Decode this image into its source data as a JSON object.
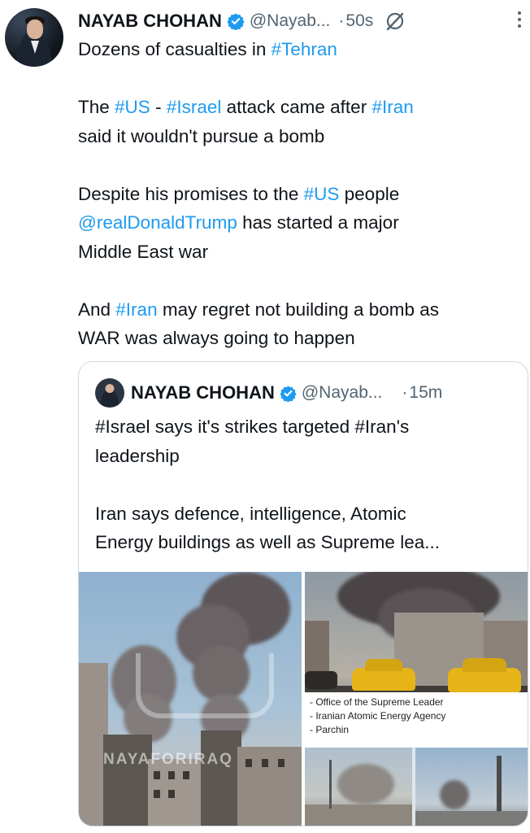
{
  "tweet": {
    "author_name": "NAYAB CHOHAN",
    "handle": "@Nayab...",
    "separator": "·",
    "time": "50s",
    "lines": {
      "l1a": "Dozens of casualties in ",
      "l1b": "#Tehran",
      "l2a": "The ",
      "l2b": "#US",
      "l2c": " - ",
      "l2d": "#Israel",
      "l2e": " attack came after ",
      "l2f": "#Iran",
      "l3": "said it wouldn't pursue a bomb",
      "l4a": "Despite his promises to the ",
      "l4b": "#US",
      "l4c": " people",
      "l5a": "@realDonaldTrump",
      "l5b": " has started a major",
      "l6": "Middle East war",
      "l7a": "And ",
      "l7b": "#Iran",
      "l7c": " may regret not building a bomb as",
      "l8": "WAR was always going to happen"
    }
  },
  "quote": {
    "author_name": "NAYAB CHOHAN",
    "handle": "@Nayab...",
    "separator": "·",
    "time": "15m",
    "line1": "#Israel says it's strikes targeted #Iran's",
    "line2": "leadership",
    "line3": "Iran says defence, intelligence, Atomic",
    "line4": "Energy buildings as well as Supreme lea...",
    "image_caption": [
      "- Office of the Supreme Leader",
      "- Iranian Atomic Energy Agency",
      "- Parchin"
    ],
    "watermark": "NAYAFORIRAQ"
  },
  "colors": {
    "link": "#1d9bf0",
    "muted": "#536471",
    "text": "#0f1419",
    "border": "#cfd9de"
  },
  "icons": {
    "verified": "verified-badge-icon",
    "grok": "grok-icon",
    "more": "more-options-icon"
  }
}
